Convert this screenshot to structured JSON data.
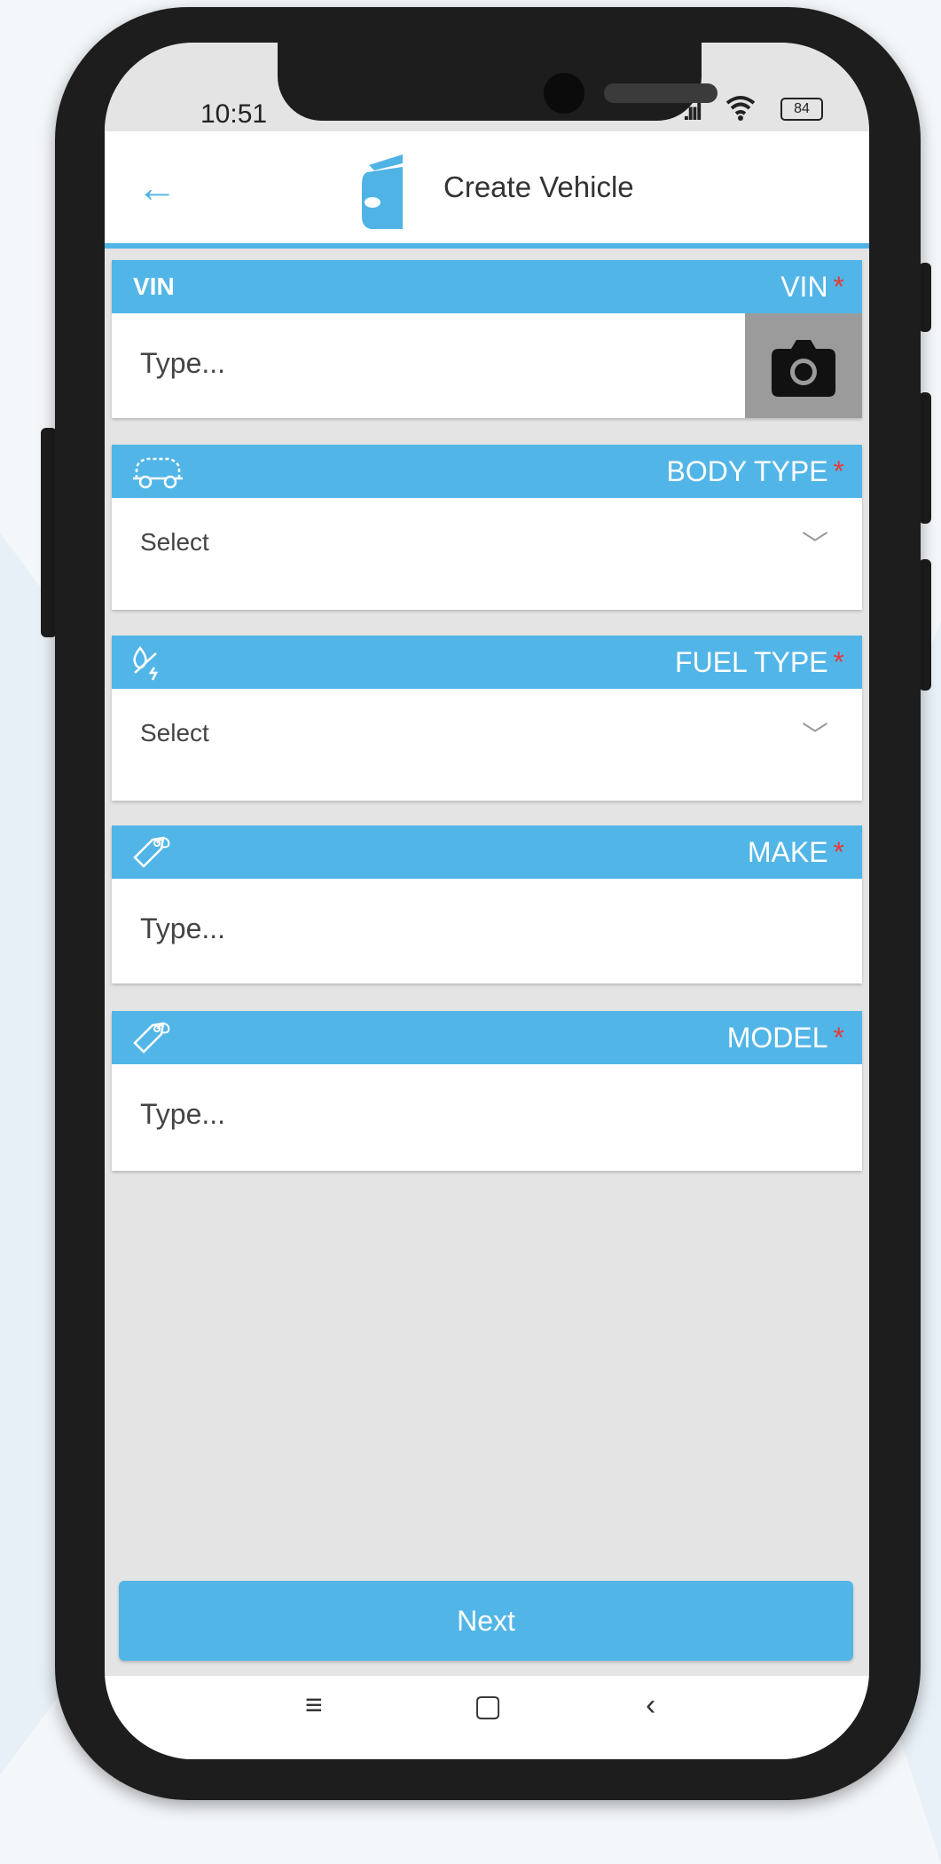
{
  "status_bar": {
    "time": "10:51",
    "battery": "84"
  },
  "app_bar": {
    "title": "Create Vehicle"
  },
  "fields": {
    "vin": {
      "left_label": "VIN",
      "label": "VIN",
      "required_mark": "*",
      "placeholder": "Type..."
    },
    "body_type": {
      "label": "BODY TYPE",
      "required_mark": "*",
      "value": "Select"
    },
    "fuel_type": {
      "label": "FUEL TYPE",
      "required_mark": "*",
      "value": "Select"
    },
    "make": {
      "label": "MAKE",
      "required_mark": "*",
      "placeholder": "Type..."
    },
    "model": {
      "label": "MODEL",
      "required_mark": "*",
      "placeholder": "Type..."
    }
  },
  "next_button": {
    "label": "Next"
  },
  "nav_bar": {
    "menu": "≡",
    "home": "▢",
    "back": "‹"
  },
  "colors": {
    "accent": "#52b5e7",
    "required": "#e53a3a",
    "screen_bg": "#e4e4e4"
  }
}
